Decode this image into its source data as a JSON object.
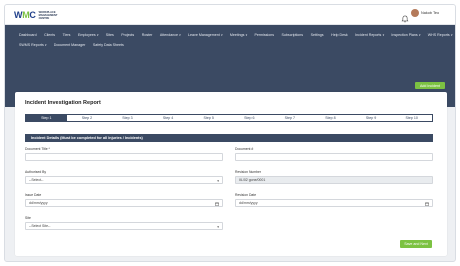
{
  "header": {
    "logo_text": "WMC",
    "logo_tagline": [
      "WORKPLACE",
      "MANAGEMENT",
      "CENTRE"
    ],
    "user_name": "Nakob Teo"
  },
  "nav": {
    "row1": [
      {
        "label": "Dashboard"
      },
      {
        "label": "Clients"
      },
      {
        "label": "Tiers"
      },
      {
        "label": "Employees",
        "dropdown": true
      },
      {
        "label": "Sites"
      },
      {
        "label": "Projects"
      },
      {
        "label": "Roster"
      },
      {
        "label": "Attendance",
        "dropdown": true
      },
      {
        "label": "Leave Management",
        "dropdown": true
      },
      {
        "label": "Meetings",
        "dropdown": true
      },
      {
        "label": "Permissions"
      },
      {
        "label": "Subscriptions"
      },
      {
        "label": "Settings"
      },
      {
        "label": "Help Desk"
      },
      {
        "label": "Incident Reports",
        "dropdown": true
      },
      {
        "label": "Inspection Plans",
        "dropdown": true
      },
      {
        "label": "WHS Reports",
        "dropdown": true
      }
    ],
    "row2": [
      {
        "label": "SWMS Reports",
        "dropdown": true
      },
      {
        "label": "Document Manager"
      },
      {
        "label": "Safety Data Sheets"
      }
    ],
    "add_button": "Add Incident"
  },
  "form": {
    "title": "Incident Investigation Report",
    "steps": [
      "Step 1",
      "Step 2",
      "Step 3",
      "Step 4",
      "Step 5",
      "Step 6",
      "Step 7",
      "Step 8",
      "Step 9",
      "Step 10"
    ],
    "active_step": 0,
    "section_title": "Incident Details (Must be completed for all Injuries / Incidents)",
    "fields": {
      "document_title": {
        "label": "Document Title *",
        "value": ""
      },
      "document_no": {
        "label": "Document #",
        "value": ""
      },
      "authorised_by": {
        "label": "Authorised By",
        "value": "--Select--"
      },
      "revision_number": {
        "label": "Revision Number",
        "value": "IIL/02 gone/0001"
      },
      "issue_date": {
        "label": "Issue Date",
        "value": "dd/mm/yyyy"
      },
      "revision_date": {
        "label": "Revision Date",
        "value": "dd/mm/yyyy"
      },
      "site": {
        "label": "Site",
        "value": "--Select Site--"
      }
    },
    "save_button": "Save and Next"
  },
  "colors": {
    "nav_bg": "#3b4a63",
    "accent_green": "#7cc242"
  }
}
